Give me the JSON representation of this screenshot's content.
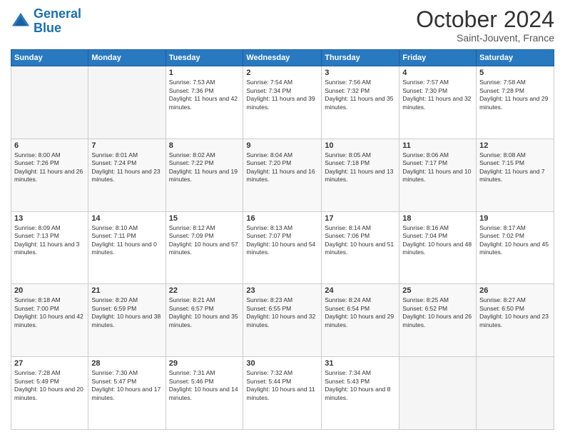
{
  "header": {
    "logo_line1": "General",
    "logo_line2": "Blue",
    "month_title": "October 2024",
    "location": "Saint-Jouvent, France"
  },
  "weekdays": [
    "Sunday",
    "Monday",
    "Tuesday",
    "Wednesday",
    "Thursday",
    "Friday",
    "Saturday"
  ],
  "weeks": [
    [
      {
        "day": "",
        "sunrise": "",
        "sunset": "",
        "daylight": "",
        "empty": true
      },
      {
        "day": "",
        "sunrise": "",
        "sunset": "",
        "daylight": "",
        "empty": true
      },
      {
        "day": "1",
        "sunrise": "Sunrise: 7:53 AM",
        "sunset": "Sunset: 7:36 PM",
        "daylight": "Daylight: 11 hours and 42 minutes."
      },
      {
        "day": "2",
        "sunrise": "Sunrise: 7:54 AM",
        "sunset": "Sunset: 7:34 PM",
        "daylight": "Daylight: 11 hours and 39 minutes."
      },
      {
        "day": "3",
        "sunrise": "Sunrise: 7:56 AM",
        "sunset": "Sunset: 7:32 PM",
        "daylight": "Daylight: 11 hours and 35 minutes."
      },
      {
        "day": "4",
        "sunrise": "Sunrise: 7:57 AM",
        "sunset": "Sunset: 7:30 PM",
        "daylight": "Daylight: 11 hours and 32 minutes."
      },
      {
        "day": "5",
        "sunrise": "Sunrise: 7:58 AM",
        "sunset": "Sunset: 7:28 PM",
        "daylight": "Daylight: 11 hours and 29 minutes."
      }
    ],
    [
      {
        "day": "6",
        "sunrise": "Sunrise: 8:00 AM",
        "sunset": "Sunset: 7:26 PM",
        "daylight": "Daylight: 11 hours and 26 minutes."
      },
      {
        "day": "7",
        "sunrise": "Sunrise: 8:01 AM",
        "sunset": "Sunset: 7:24 PM",
        "daylight": "Daylight: 11 hours and 23 minutes."
      },
      {
        "day": "8",
        "sunrise": "Sunrise: 8:02 AM",
        "sunset": "Sunset: 7:22 PM",
        "daylight": "Daylight: 11 hours and 19 minutes."
      },
      {
        "day": "9",
        "sunrise": "Sunrise: 8:04 AM",
        "sunset": "Sunset: 7:20 PM",
        "daylight": "Daylight: 11 hours and 16 minutes."
      },
      {
        "day": "10",
        "sunrise": "Sunrise: 8:05 AM",
        "sunset": "Sunset: 7:18 PM",
        "daylight": "Daylight: 11 hours and 13 minutes."
      },
      {
        "day": "11",
        "sunrise": "Sunrise: 8:06 AM",
        "sunset": "Sunset: 7:17 PM",
        "daylight": "Daylight: 11 hours and 10 minutes."
      },
      {
        "day": "12",
        "sunrise": "Sunrise: 8:08 AM",
        "sunset": "Sunset: 7:15 PM",
        "daylight": "Daylight: 11 hours and 7 minutes."
      }
    ],
    [
      {
        "day": "13",
        "sunrise": "Sunrise: 8:09 AM",
        "sunset": "Sunset: 7:13 PM",
        "daylight": "Daylight: 11 hours and 3 minutes."
      },
      {
        "day": "14",
        "sunrise": "Sunrise: 8:10 AM",
        "sunset": "Sunset: 7:11 PM",
        "daylight": "Daylight: 11 hours and 0 minutes."
      },
      {
        "day": "15",
        "sunrise": "Sunrise: 8:12 AM",
        "sunset": "Sunset: 7:09 PM",
        "daylight": "Daylight: 10 hours and 57 minutes."
      },
      {
        "day": "16",
        "sunrise": "Sunrise: 8:13 AM",
        "sunset": "Sunset: 7:07 PM",
        "daylight": "Daylight: 10 hours and 54 minutes."
      },
      {
        "day": "17",
        "sunrise": "Sunrise: 8:14 AM",
        "sunset": "Sunset: 7:06 PM",
        "daylight": "Daylight: 10 hours and 51 minutes."
      },
      {
        "day": "18",
        "sunrise": "Sunrise: 8:16 AM",
        "sunset": "Sunset: 7:04 PM",
        "daylight": "Daylight: 10 hours and 48 minutes."
      },
      {
        "day": "19",
        "sunrise": "Sunrise: 8:17 AM",
        "sunset": "Sunset: 7:02 PM",
        "daylight": "Daylight: 10 hours and 45 minutes."
      }
    ],
    [
      {
        "day": "20",
        "sunrise": "Sunrise: 8:18 AM",
        "sunset": "Sunset: 7:00 PM",
        "daylight": "Daylight: 10 hours and 42 minutes."
      },
      {
        "day": "21",
        "sunrise": "Sunrise: 8:20 AM",
        "sunset": "Sunset: 6:59 PM",
        "daylight": "Daylight: 10 hours and 38 minutes."
      },
      {
        "day": "22",
        "sunrise": "Sunrise: 8:21 AM",
        "sunset": "Sunset: 6:57 PM",
        "daylight": "Daylight: 10 hours and 35 minutes."
      },
      {
        "day": "23",
        "sunrise": "Sunrise: 8:23 AM",
        "sunset": "Sunset: 6:55 PM",
        "daylight": "Daylight: 10 hours and 32 minutes."
      },
      {
        "day": "24",
        "sunrise": "Sunrise: 8:24 AM",
        "sunset": "Sunset: 6:54 PM",
        "daylight": "Daylight: 10 hours and 29 minutes."
      },
      {
        "day": "25",
        "sunrise": "Sunrise: 8:25 AM",
        "sunset": "Sunset: 6:52 PM",
        "daylight": "Daylight: 10 hours and 26 minutes."
      },
      {
        "day": "26",
        "sunrise": "Sunrise: 8:27 AM",
        "sunset": "Sunset: 6:50 PM",
        "daylight": "Daylight: 10 hours and 23 minutes."
      }
    ],
    [
      {
        "day": "27",
        "sunrise": "Sunrise: 7:28 AM",
        "sunset": "Sunset: 5:49 PM",
        "daylight": "Daylight: 10 hours and 20 minutes."
      },
      {
        "day": "28",
        "sunrise": "Sunrise: 7:30 AM",
        "sunset": "Sunset: 5:47 PM",
        "daylight": "Daylight: 10 hours and 17 minutes."
      },
      {
        "day": "29",
        "sunrise": "Sunrise: 7:31 AM",
        "sunset": "Sunset: 5:46 PM",
        "daylight": "Daylight: 10 hours and 14 minutes."
      },
      {
        "day": "30",
        "sunrise": "Sunrise: 7:32 AM",
        "sunset": "Sunset: 5:44 PM",
        "daylight": "Daylight: 10 hours and 11 minutes."
      },
      {
        "day": "31",
        "sunrise": "Sunrise: 7:34 AM",
        "sunset": "Sunset: 5:43 PM",
        "daylight": "Daylight: 10 hours and 8 minutes."
      },
      {
        "day": "",
        "sunrise": "",
        "sunset": "",
        "daylight": "",
        "empty": true
      },
      {
        "day": "",
        "sunrise": "",
        "sunset": "",
        "daylight": "",
        "empty": true
      }
    ]
  ]
}
